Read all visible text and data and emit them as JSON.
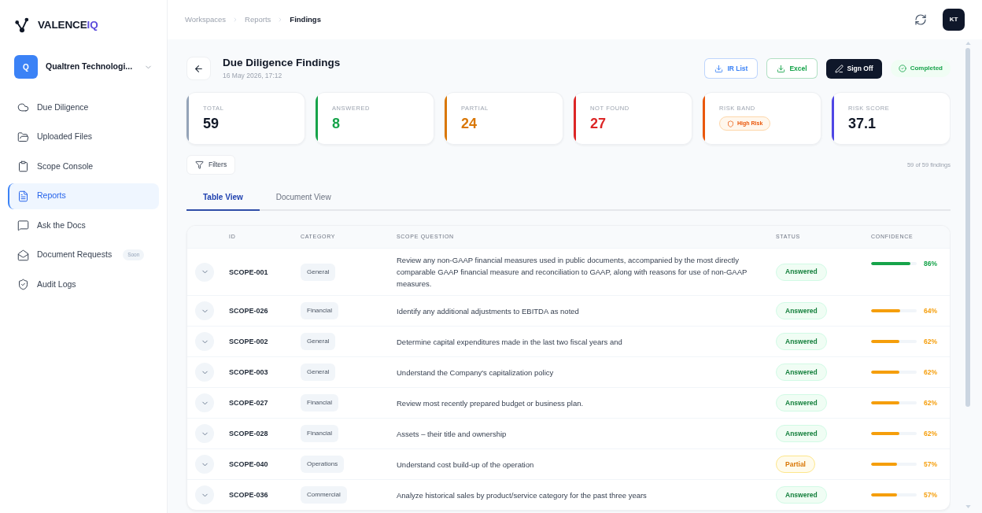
{
  "sidebar": {
    "brand": {
      "name": "VALENCE",
      "accent": "IQ"
    },
    "workspace": {
      "initial": "Q",
      "name": "Qualtren Technologi..."
    },
    "nav_items": [
      {
        "label": "Due Diligence",
        "selected": false
      },
      {
        "label": "Uploaded Files",
        "selected": false
      },
      {
        "label": "Scope Console",
        "selected": false
      },
      {
        "label": "Reports",
        "selected": true
      },
      {
        "label": "Ask the Docs",
        "selected": false
      },
      {
        "label": "Document Requests",
        "selected": false,
        "badge": "Soon"
      },
      {
        "label": "Audit Logs",
        "selected": false
      }
    ]
  },
  "header": {
    "breadcrumbs": [
      {
        "label": "Workspaces",
        "current": false
      },
      {
        "label": "Reports",
        "current": false
      },
      {
        "label": "Findings",
        "current": true
      }
    ],
    "avatar": "KT"
  },
  "page": {
    "title": "Due Diligence Findings",
    "subtitle": "16 May 2026, 17:12",
    "actions": [
      {
        "label": "IR List",
        "kind": "outline",
        "color": "#3b82f6"
      },
      {
        "label": "Excel",
        "kind": "outline",
        "color": "#16a34a"
      },
      {
        "label": "Sign Off",
        "kind": "primary"
      }
    ],
    "status": "Completed"
  },
  "stats": [
    {
      "label": "TOTAL",
      "value": "59",
      "kind": "plain",
      "color": "#94a3b8"
    },
    {
      "label": "ANSWERED",
      "value": "8",
      "kind": "accent",
      "color": "#16a34a"
    },
    {
      "label": "PARTIAL",
      "value": "24",
      "kind": "accent",
      "color": "#d97706"
    },
    {
      "label": "NOT FOUND",
      "value": "27",
      "kind": "accent",
      "color": "#dc2626"
    },
    {
      "label": "RISK BAND",
      "value": "High Risk",
      "kind": "badge",
      "color": "#ea580c"
    },
    {
      "label": "RISK SCORE",
      "value": "37.1",
      "kind": "plain",
      "color": "#4f46e5"
    }
  ],
  "toolbar": {
    "filter_button": "Filters",
    "count": "59 of 59 findings"
  },
  "tabs": [
    {
      "label": "Table View",
      "selected": true
    },
    {
      "label": "Document View",
      "selected": false
    }
  ],
  "table": {
    "columns": [
      "ID",
      "CATEGORY",
      "SCOPE QUESTION",
      "STATUS",
      "CONFIDENCE"
    ],
    "rows": [
      {
        "id": "SCOPE-001",
        "category": "General",
        "question": "Review any non-GAAP financial measures used in public documents, accompanied by the most directly comparable GAAP financial measure and reconciliation to GAAP, along with reasons for use of non-GAAP measures.",
        "status": {
          "label": "Answered",
          "kind": "answered"
        },
        "confidence": {
          "level": 0.86,
          "reading": "86%"
        },
        "expanded": false
      },
      {
        "id": "SCOPE-026",
        "category": "Financial",
        "question": "Identify any additional adjustments to EBITDA as noted",
        "status": {
          "label": "Answered",
          "kind": "answered"
        },
        "confidence": {
          "level": 0.64,
          "reading": "64%"
        },
        "expanded": false
      },
      {
        "id": "SCOPE-002",
        "category": "General",
        "question": "Determine capital expenditures made in the last two fiscal years and",
        "status": {
          "label": "Answered",
          "kind": "answered"
        },
        "confidence": {
          "level": 0.62,
          "reading": "62%"
        },
        "expanded": false
      },
      {
        "id": "SCOPE-003",
        "category": "General",
        "question": "Understand the Company's capitalization policy",
        "status": {
          "label": "Answered",
          "kind": "answered"
        },
        "confidence": {
          "level": 0.62,
          "reading": "62%"
        },
        "expanded": false
      },
      {
        "id": "SCOPE-027",
        "category": "Financial",
        "question": "Review most recently prepared budget or business plan.",
        "status": {
          "label": "Answered",
          "kind": "answered"
        },
        "confidence": {
          "level": 0.62,
          "reading": "62%"
        },
        "expanded": false
      },
      {
        "id": "SCOPE-028",
        "category": "Financial",
        "question": "Assets – their title and ownership",
        "status": {
          "label": "Answered",
          "kind": "answered"
        },
        "confidence": {
          "level": 0.62,
          "reading": "62%"
        },
        "expanded": false
      },
      {
        "id": "SCOPE-040",
        "category": "Operations",
        "question": "Understand cost build-up of the operation",
        "status": {
          "label": "Partial",
          "kind": "partial"
        },
        "confidence": {
          "level": 0.57,
          "reading": "57%"
        },
        "expanded": false
      },
      {
        "id": "SCOPE-036",
        "category": "Commercial",
        "question": "Analyze historical sales by product/service category for the past three years",
        "status": {
          "label": "Answered",
          "kind": "answered"
        },
        "confidence": {
          "level": 0.57,
          "reading": "57%"
        },
        "expanded": false
      }
    ]
  }
}
